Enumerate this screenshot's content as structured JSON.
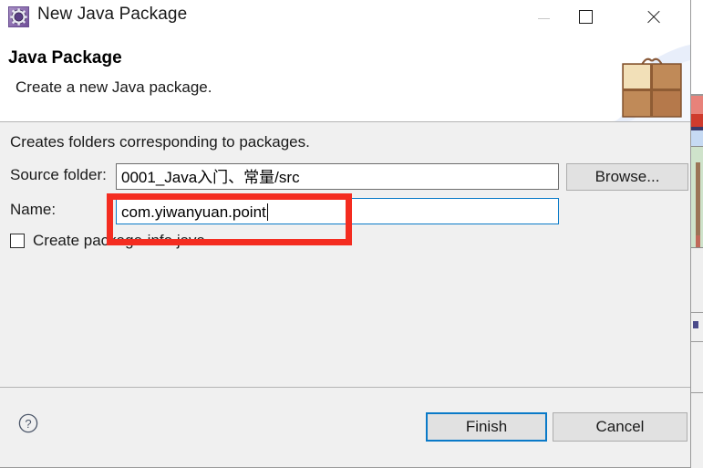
{
  "window": {
    "title": "New Java Package",
    "icon": "java-package-gear-icon",
    "controls": {
      "minimize": "minimize-icon",
      "maximize": "maximize-icon",
      "close": "close-icon"
    }
  },
  "header": {
    "title": "Java Package",
    "subtitle": "Create a new Java package.",
    "decoration_icon": "gift-box-icon"
  },
  "body": {
    "intro": "Creates folders corresponding to packages.",
    "source_folder": {
      "label": "Source folder:",
      "value": "0001_Java入门、常量/src",
      "browse_label": "Browse..."
    },
    "name": {
      "label": "Name:",
      "value": "com.yiwanyuan.point",
      "placeholder": ""
    },
    "create_package_info": {
      "label": "Create package-info.java",
      "checked": false
    }
  },
  "footer": {
    "help_icon": "help-question-icon",
    "finish_label": "Finish",
    "cancel_label": "Cancel"
  },
  "annotation": {
    "type": "highlight-rectangle",
    "color": "#f42c20",
    "target": "name-input"
  },
  "colors": {
    "dialog_background": "#f0f0f0",
    "header_background": "#ffffff",
    "focus_border": "#0a7ac8",
    "annotation_red": "#f42c20",
    "title_icon_purple": "#6f4f96"
  }
}
